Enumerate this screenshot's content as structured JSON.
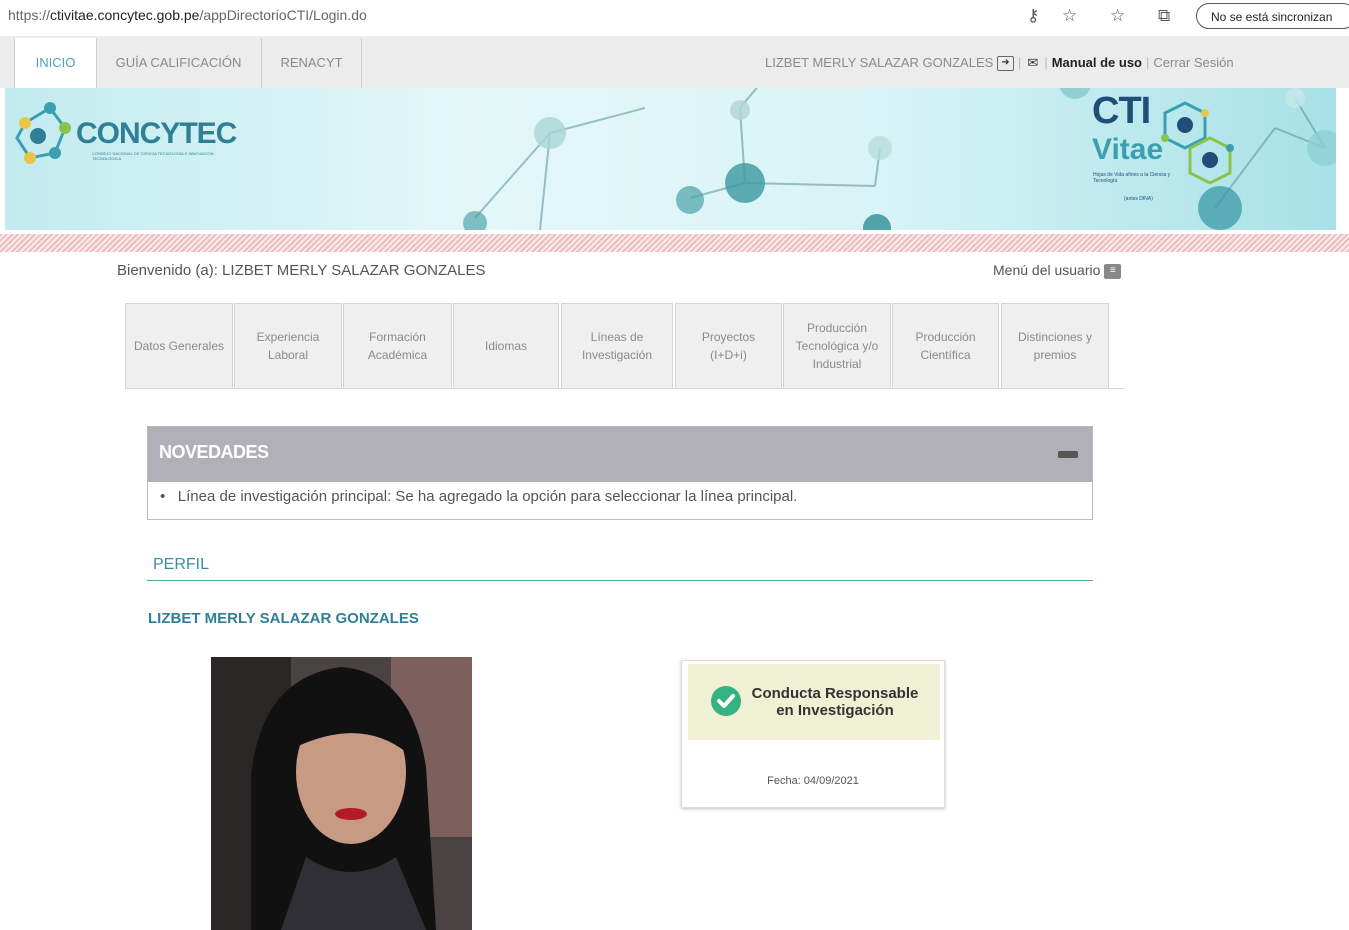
{
  "browser": {
    "url_scheme": "https://",
    "url_host": "ctivitae.concytec.gob.pe",
    "url_path": "/appDirectorioCTI/Login.do",
    "sync_label": "No se está sincronizan"
  },
  "topnav": {
    "tabs": [
      "INICIO",
      "GUÍA CALIFICACIÓN",
      "RENACYT"
    ],
    "user_name": "LIZBET MERLY SALAZAR GONZALES",
    "manual": "Manual de uso",
    "logout": "Cerrar Sesión"
  },
  "banner": {
    "logo_left": "CONCYTEC",
    "logo_left_sub": "CONSEJO NACIONAL DE CIENCIA TECNOLOGÍA E INNOVACIÓN TECNOLÓGICA",
    "logo_right_a": "CTI",
    "logo_right_b": "Vitae",
    "logo_right_sub": "Hojas de Vida afines a la Ciencia y Tecnología",
    "logo_right_sub2": "(antes DINA)"
  },
  "welcome": "Bienvenido (a): LIZBET MERLY SALAZAR GONZALES",
  "menu_usuario": "Menú del usuario",
  "profile_tabs": [
    "Datos Generales",
    "Experiencia Laboral",
    "Formación Académica",
    "Idiomas",
    "Líneas de Investigación",
    "Proyectos (I+D+i)",
    "Producción Tecnológica y/o Industrial",
    "Producción Científica",
    "Distinciones y premios"
  ],
  "novedades": {
    "title": "NOVEDADES",
    "items": [
      "Línea de investigación principal: Se ha agregado la opción para seleccionar la línea principal."
    ]
  },
  "perfil": {
    "title": "PERFIL",
    "name": "LIZBET MERLY SALAZAR GONZALES"
  },
  "badge": {
    "line1": "Conducta Responsable",
    "line2": "en Investigación",
    "date": "Fecha: 04/09/2021"
  },
  "colors": {
    "accent": "#4aa3b6",
    "novedades_header": "#b1b0b8",
    "badge_bg": "#f0f0d4",
    "check": "#34b27f"
  }
}
